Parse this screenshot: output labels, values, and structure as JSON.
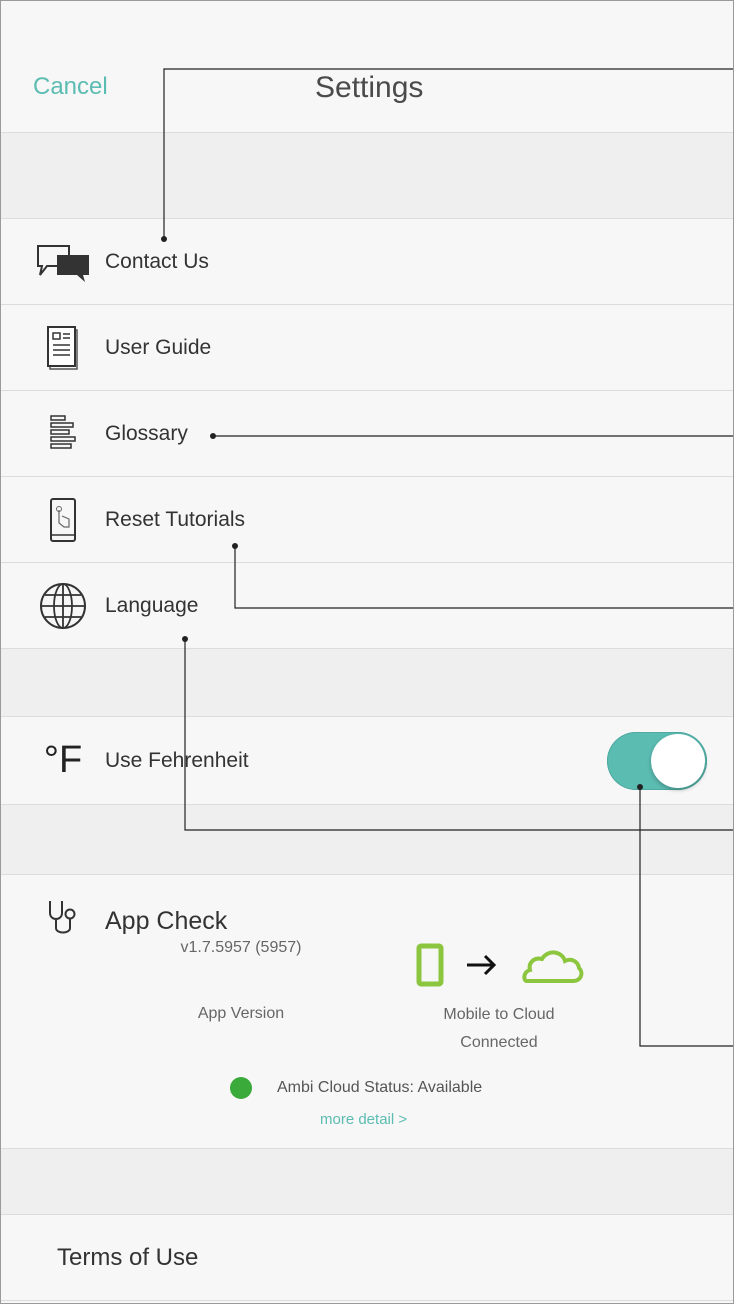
{
  "header": {
    "cancel_label": "Cancel",
    "title": "Settings"
  },
  "menu": [
    {
      "label": "Contact Us",
      "icon": "chat-bubbles-icon"
    },
    {
      "label": "User Guide",
      "icon": "document-icon"
    },
    {
      "label": "Glossary",
      "icon": "list-icon"
    },
    {
      "label": "Reset Tutorials",
      "icon": "phone-tap-icon"
    },
    {
      "label": "Language",
      "icon": "globe-icon"
    }
  ],
  "units": {
    "label": "Use Fehrenheit",
    "icon_text": "°F",
    "toggle_on": true
  },
  "app_check": {
    "title": "App Check",
    "version": "v1.7.5957 (5957)",
    "version_label": "App Version",
    "connection_label_line1": "Mobile to Cloud",
    "connection_label_line2": "Connected",
    "cloud_status": "Ambi Cloud Status: Available",
    "more_detail": "more detail >"
  },
  "footer": {
    "terms_label": "Terms of Use"
  },
  "colors": {
    "accent": "#5bbcb2",
    "status_green": "#3aaa3a",
    "mobile_green": "#8cc63f"
  }
}
